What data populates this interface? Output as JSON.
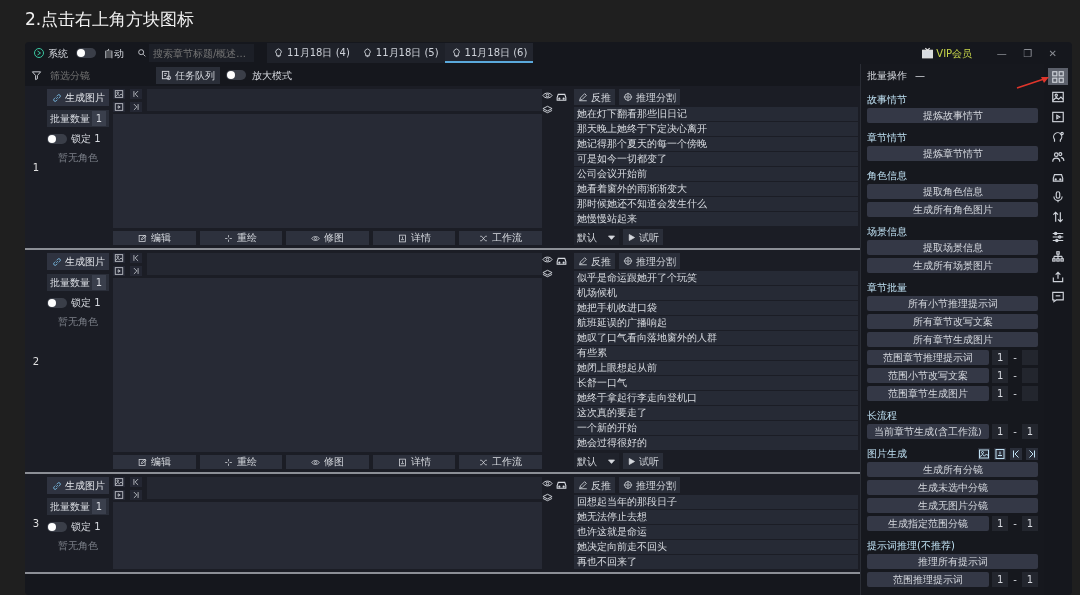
{
  "heading": "2.点击右上角方块图标",
  "titlebar": {
    "logo_text": "系统",
    "toggle": {
      "label": "自动",
      "on": false
    },
    "search": {
      "placeholder": "搜索章节标题/概述..."
    },
    "tabs": [
      {
        "label": "11月18日 (4)",
        "selected": false
      },
      {
        "label": "11月18日 (5)",
        "selected": false
      },
      {
        "label": "11月18日 (6)",
        "selected": true
      }
    ],
    "vip": "VIP会员",
    "window_controls": [
      "—",
      "❐",
      "✕"
    ]
  },
  "toolbar": {
    "filter_placeholder": "筛选分镜",
    "queue_button": "任务队列",
    "toggle": {
      "label": "放大模式",
      "on": false
    }
  },
  "rows": [
    {
      "number": "1",
      "generate_button": "生成图片",
      "batch": {
        "label": "批量数量",
        "value": "1"
      },
      "lock": {
        "label": "锁定 1",
        "on": false
      },
      "role": "暂无角色",
      "tools": [
        "反推",
        "推理分割"
      ],
      "lines": [
        "她在灯下翻看那些旧日记",
        "那天晚上她终于下定决心离开",
        "她记得那个夏天的每一个傍晚",
        "可是如今一切都变了",
        "公司会议开始前",
        "她看着窗外的雨渐渐变大",
        "那时候她还不知道会发生什么",
        "她慢慢站起来"
      ],
      "voice": "默认",
      "listen_button": "试听",
      "actions": [
        "编辑",
        "重绘",
        "修图",
        "详情",
        "工作流"
      ]
    },
    {
      "number": "2",
      "generate_button": "生成图片",
      "batch": {
        "label": "批量数量",
        "value": "1"
      },
      "lock": {
        "label": "锁定 1",
        "on": false
      },
      "role": "暂无角色",
      "tools": [
        "反推",
        "推理分割"
      ],
      "lines": [
        "似乎是命运跟她开了个玩笑",
        "机场候机",
        "她把手机收进口袋",
        "航班延误的广播响起",
        "她叹了口气看向落地窗外的人群",
        "有些累",
        "她闭上眼想起从前",
        "长舒一口气",
        "她终于拿起行李走向登机口",
        "这次真的要走了",
        "一个新的开始",
        "她会过得很好的"
      ],
      "voice": "默认",
      "listen_button": "试听",
      "actions": [
        "编辑",
        "重绘",
        "修图",
        "详情",
        "工作流"
      ]
    },
    {
      "number": "3",
      "generate_button": "生成图片",
      "batch": {
        "label": "批量数量",
        "value": "1"
      },
      "lock": {
        "label": "锁定 1",
        "on": false
      },
      "role": "暂无角色",
      "tools": [
        "反推",
        "推理分割"
      ],
      "lines": [
        "回想起当年的那段日子",
        "她无法停止去想",
        "也许这就是命运",
        "她决定向前走不回头",
        "再也不回来了"
      ]
    }
  ],
  "panel": {
    "title": "批量操作",
    "collapse": "—",
    "sections": [
      {
        "title": "故事情节",
        "items": [
          {
            "kind": "button",
            "label": "提炼故事情节"
          }
        ]
      },
      {
        "title": "章节情节",
        "items": [
          {
            "kind": "button",
            "label": "提炼章节情节"
          }
        ]
      },
      {
        "title": "角色信息",
        "items": [
          {
            "kind": "button",
            "label": "提取角色信息"
          },
          {
            "kind": "button",
            "label": "生成所有角色图片"
          }
        ]
      },
      {
        "title": "场景信息",
        "items": [
          {
            "kind": "button",
            "label": "提取场景信息"
          },
          {
            "kind": "button",
            "label": "生成所有场景图片"
          }
        ]
      },
      {
        "title": "章节批量",
        "items": [
          {
            "kind": "button",
            "label": "所有小节推理提示词"
          },
          {
            "kind": "button",
            "label": "所有章节改写文案"
          },
          {
            "kind": "button",
            "label": "所有章节生成图片"
          },
          {
            "kind": "range",
            "label": "范围章节推理提示词",
            "from": "1",
            "separator": "-"
          },
          {
            "kind": "range",
            "label": "范围小节改写文案",
            "from": "1",
            "separator": "-"
          },
          {
            "kind": "range",
            "label": "范围章节生成图片",
            "from": "1",
            "separator": "-"
          }
        ]
      },
      {
        "title": "长流程",
        "items": [
          {
            "kind": "range",
            "label": "当前章节生成(含工作流)",
            "from": "1",
            "separator": "-",
            "to": "1"
          }
        ]
      },
      {
        "title": "图片生成",
        "tool_icons": true,
        "items": [
          {
            "kind": "button",
            "label": "生成所有分镜"
          },
          {
            "kind": "button",
            "label": "生成未选中分镜"
          },
          {
            "kind": "button",
            "label": "生成无图片分镜"
          },
          {
            "kind": "range",
            "label": "生成指定范围分镜",
            "from": "1",
            "separator": "-",
            "to": "1"
          }
        ]
      },
      {
        "title": "提示词推理(不推荐)",
        "items": [
          {
            "kind": "button",
            "label": "推理所有提示词"
          },
          {
            "kind": "range",
            "label": "范围推理提示词",
            "from": "1",
            "separator": "-",
            "to": "1"
          }
        ]
      }
    ]
  },
  "side_tools": [
    {
      "selected": true
    },
    {
      "selected": false
    },
    {
      "selected": false
    },
    {
      "selected": false
    },
    {
      "selected": false
    },
    {
      "selected": false
    },
    {
      "selected": false
    },
    {
      "selected": false
    },
    {
      "selected": false
    },
    {
      "selected": false
    },
    {
      "selected": false
    },
    {
      "selected": false
    }
  ]
}
